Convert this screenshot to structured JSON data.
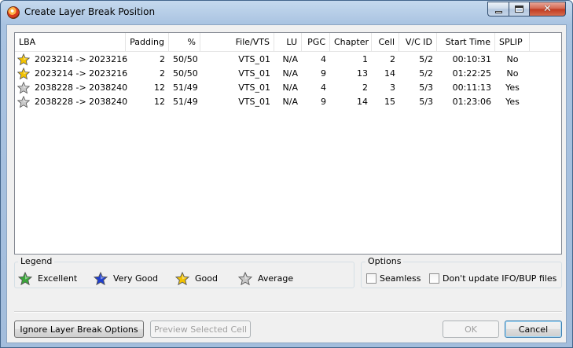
{
  "window": {
    "title": "Create Layer Break Position"
  },
  "colors": {
    "excellent": "#3aa63a",
    "very_good": "#1f3fcf",
    "good": "#f2c200",
    "average": "#c8c8c8"
  },
  "table": {
    "columns": [
      "LBA",
      "Padding",
      "%",
      "File/VTS",
      "LU",
      "PGC",
      "Chapter",
      "Cell",
      "V/C ID",
      "Start Time",
      "SPLIP"
    ],
    "rows": [
      {
        "rating": "good",
        "cells": [
          "2023214 -> 2023216",
          "2",
          "50/50",
          "VTS_01",
          "N/A",
          "4",
          "1",
          "2",
          "5/2",
          "00:10:31",
          "No"
        ]
      },
      {
        "rating": "good",
        "cells": [
          "2023214 -> 2023216",
          "2",
          "50/50",
          "VTS_01",
          "N/A",
          "9",
          "13",
          "14",
          "5/2",
          "01:22:25",
          "No"
        ]
      },
      {
        "rating": "average",
        "cells": [
          "2038228 -> 2038240",
          "12",
          "51/49",
          "VTS_01",
          "N/A",
          "4",
          "2",
          "3",
          "5/3",
          "00:11:13",
          "Yes"
        ]
      },
      {
        "rating": "average",
        "cells": [
          "2038228 -> 2038240",
          "12",
          "51/49",
          "VTS_01",
          "N/A",
          "9",
          "14",
          "15",
          "5/3",
          "01:23:06",
          "Yes"
        ]
      }
    ]
  },
  "legend": {
    "title": "Legend",
    "items": [
      {
        "icon": "star-icon",
        "color": "#3aa63a",
        "label": "Excellent"
      },
      {
        "icon": "star-icon",
        "color": "#1f3fcf",
        "label": "Very Good"
      },
      {
        "icon": "star-icon",
        "color": "#f2c200",
        "label": "Good"
      },
      {
        "icon": "star-icon",
        "color": "#c8c8c8",
        "label": "Average"
      }
    ]
  },
  "options": {
    "title": "Options",
    "seamless_label": "Seamless",
    "seamless_checked": false,
    "no_update_label": "Don't update IFO/BUP files",
    "no_update_checked": false
  },
  "buttons": {
    "ignore": "Ignore Layer Break Options",
    "preview": "Preview Selected Cell",
    "ok": "OK",
    "cancel": "Cancel"
  }
}
